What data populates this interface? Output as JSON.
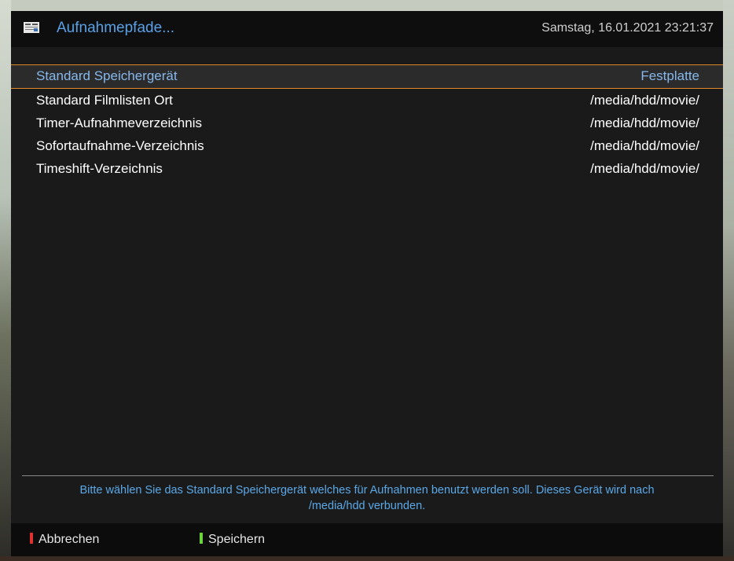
{
  "header": {
    "title": "Aufnahmepfade...",
    "datetime": "Samstag, 16.01.2021  23:21:37",
    "icon": "menu-card-icon"
  },
  "rows": [
    {
      "label": "Standard Speichergerät",
      "value": "Festplatte",
      "selected": true
    },
    {
      "label": "Standard Filmlisten Ort",
      "value": "/media/hdd/movie/",
      "selected": false
    },
    {
      "label": "Timer-Aufnahmeverzeichnis",
      "value": "/media/hdd/movie/",
      "selected": false
    },
    {
      "label": "Sofortaufnahme-Verzeichnis",
      "value": "/media/hdd/movie/",
      "selected": false
    },
    {
      "label": "Timeshift-Verzeichnis",
      "value": "/media/hdd/movie/",
      "selected": false
    }
  ],
  "help_text_line1": "Bitte wählen Sie das Standard Speichergerät welches für Aufnahmen benutzt werden soll. Dieses Gerät wird nach",
  "help_text_line2": "/media/hdd verbunden.",
  "footer": {
    "red_label": "Abbrechen",
    "green_label": "Speichern",
    "red_color": "#e03030",
    "green_color": "#6ed23a"
  },
  "colors": {
    "accent": "#5aa0e6",
    "selection_border": "#e08a2c",
    "selected_text": "#86b8ee"
  }
}
